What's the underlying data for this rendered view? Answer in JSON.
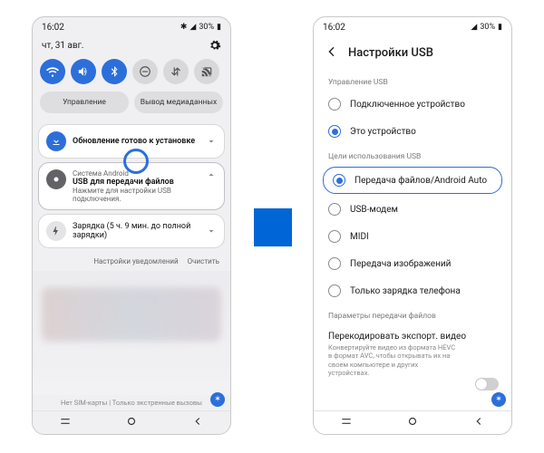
{
  "phone1": {
    "status": {
      "time": "16:02",
      "bt_icon": "bluetooth",
      "battery": "30%",
      "signal": "▲"
    },
    "date": "чт, 31 авг.",
    "quick": [
      "wifi",
      "volume",
      "bluetooth",
      "dnd",
      "data",
      "cast"
    ],
    "pills": {
      "manage": "Управление",
      "media": "Вывод медиаданных"
    },
    "card_update": {
      "title": "Обновление готово к установке"
    },
    "card_usb": {
      "source": "Система Android",
      "title": "USB для передачи файлов",
      "sub": "Нажмите для настройки USB подключения."
    },
    "card_charge": {
      "title": "Зарядка (5 ч. 9 мин. до полной зарядки)"
    },
    "footer": {
      "settings": "Настройки уведомлений",
      "clear": "Очистить"
    },
    "bottom": "Нет SIM-карты | Только экстренные вызовы"
  },
  "phone2": {
    "status": {
      "time": "16:02",
      "battery": "30%"
    },
    "title": "Настройки USB",
    "sec1": "Управление USB",
    "opt_connected": "Подключенное устройство",
    "opt_this": "Это устройство",
    "sec2": "Цели использования USB",
    "opt_file": "Передача файлов/Android Auto",
    "opt_tether": "USB-модем",
    "opt_midi": "MIDI",
    "opt_ptp": "Передача изображений",
    "opt_charge": "Только зарядка телефона",
    "sec3": "Параметры передачи файлов",
    "switch_title": "Перекодировать экспорт. видео",
    "switch_desc": "Конвертируйте видео из формата HEVC в формат AVC, чтобы открывать их на своем компьютере и других устройствах."
  }
}
